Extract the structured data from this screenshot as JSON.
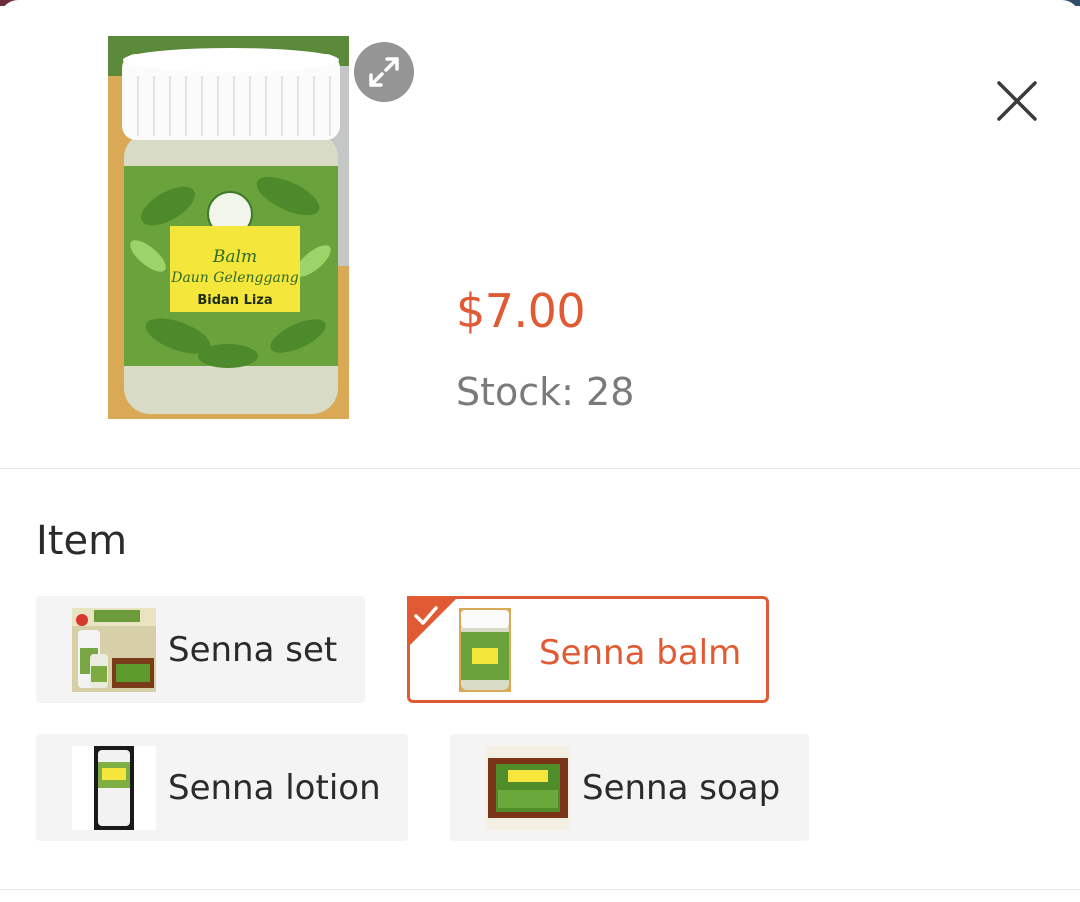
{
  "product": {
    "price": "$7.00",
    "stock": "Stock: 28",
    "image_label_line1": "Balm",
    "image_label_line2": "Daun Gelenggang",
    "image_label_line3": "Bidan Liza"
  },
  "icons": {
    "expand": "expand-icon",
    "close": "close-icon",
    "check": "check-icon"
  },
  "colors": {
    "accent": "#e05a33",
    "muted_text": "#7a7a7a",
    "option_bg": "#f4f4f4"
  },
  "variation": {
    "title": "Item",
    "options": [
      {
        "label": "Senna set",
        "selected": false
      },
      {
        "label": "Senna balm",
        "selected": true
      },
      {
        "label": "Senna lotion",
        "selected": false
      },
      {
        "label": "Senna soap",
        "selected": false
      }
    ]
  }
}
